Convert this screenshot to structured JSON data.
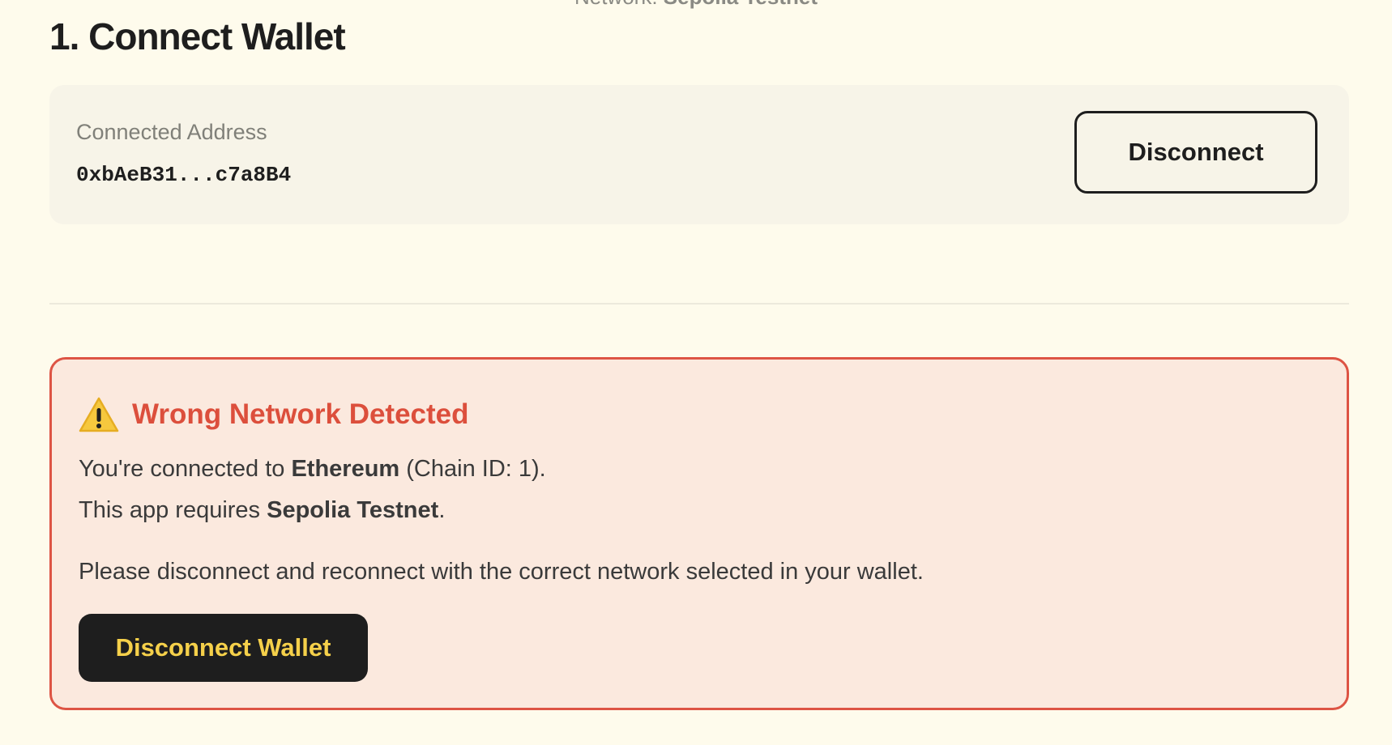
{
  "network": {
    "label": "Network:",
    "name": "Sepolia Testnet"
  },
  "page": {
    "title": "1. Connect Wallet"
  },
  "connection": {
    "label": "Connected Address",
    "address": "0xbAeB31...c7a8B4",
    "disconnect_label": "Disconnect"
  },
  "alert": {
    "icon": "warning-icon",
    "title": "Wrong Network Detected",
    "line1_prefix": "You're connected to ",
    "line1_network": "Ethereum",
    "line1_suffix": " (Chain ID: 1).",
    "line2_prefix": "This app requires ",
    "line2_network": "Sepolia Testnet",
    "line2_suffix": ".",
    "instruction": "Please disconnect and reconnect with the correct network selected in your wallet.",
    "button_label": "Disconnect Wallet"
  },
  "colors": {
    "background": "#fefbec",
    "card": "#f7f4e8",
    "alert_bg": "#fbe9de",
    "alert_border": "#dd5444",
    "alert_title": "#dc4f3c",
    "button_dark": "#1e1e1e",
    "button_accent_text": "#f5d04a"
  }
}
